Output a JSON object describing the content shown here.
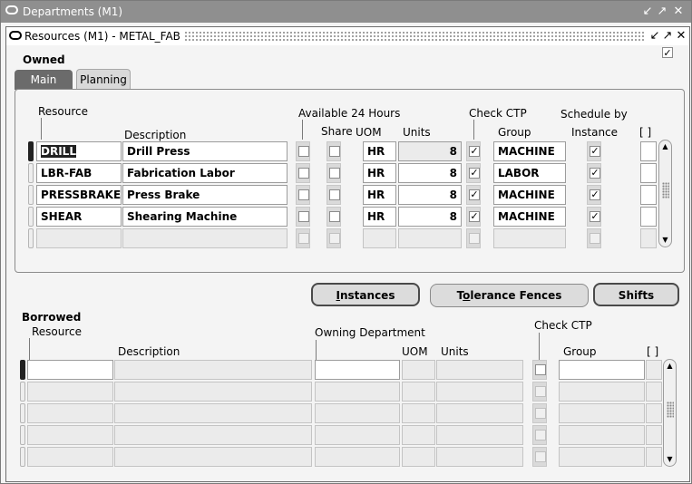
{
  "outer_window": {
    "title": "Departments (M1)"
  },
  "inner_window": {
    "title": "Resources (M1) - METAL_FAB"
  },
  "owned": {
    "label": "Owned",
    "checked": true,
    "tabs": [
      {
        "label": "Main",
        "active": true
      },
      {
        "label": "Planning",
        "active": false
      }
    ],
    "headers": {
      "resource": "Resource",
      "description": "Description",
      "available_24": "Available 24 Hours",
      "share": "Share",
      "uom": "UOM",
      "units": "Units",
      "check_ctp": "Check CTP",
      "group": "Group",
      "schedule_by": "Schedule by",
      "instance": "Instance",
      "flex": "[ ]"
    },
    "rows": [
      {
        "resource": "DRILL",
        "description": "Drill Press",
        "available_24": false,
        "share": false,
        "uom": "HR",
        "units": "8",
        "check_ctp": true,
        "group": "MACHINE",
        "schedule_by_instance": true
      },
      {
        "resource": "LBR-FAB",
        "description": "Fabrication Labor",
        "available_24": false,
        "share": false,
        "uom": "HR",
        "units": "8",
        "check_ctp": true,
        "group": "LABOR",
        "schedule_by_instance": true
      },
      {
        "resource": "PRESSBRAKE",
        "description": "Press Brake",
        "available_24": false,
        "share": false,
        "uom": "HR",
        "units": "8",
        "check_ctp": true,
        "group": "MACHINE",
        "schedule_by_instance": true
      },
      {
        "resource": "SHEAR",
        "description": "Shearing Machine",
        "available_24": false,
        "share": false,
        "uom": "HR",
        "units": "8",
        "check_ctp": true,
        "group": "MACHINE",
        "schedule_by_instance": true
      }
    ]
  },
  "buttons": {
    "instances": {
      "label": "Instances",
      "mnemonic": "I"
    },
    "tolerance_fences": {
      "label": "Tolerance Fences",
      "mnemonic": "o"
    },
    "shifts": {
      "label": "Shifts"
    }
  },
  "borrowed": {
    "label": "Borrowed",
    "headers": {
      "resource": "Resource",
      "description": "Description",
      "owning_department": "Owning Department",
      "uom": "UOM",
      "units": "Units",
      "check_ctp": "Check CTP",
      "group": "Group",
      "flex": "[ ]"
    }
  }
}
